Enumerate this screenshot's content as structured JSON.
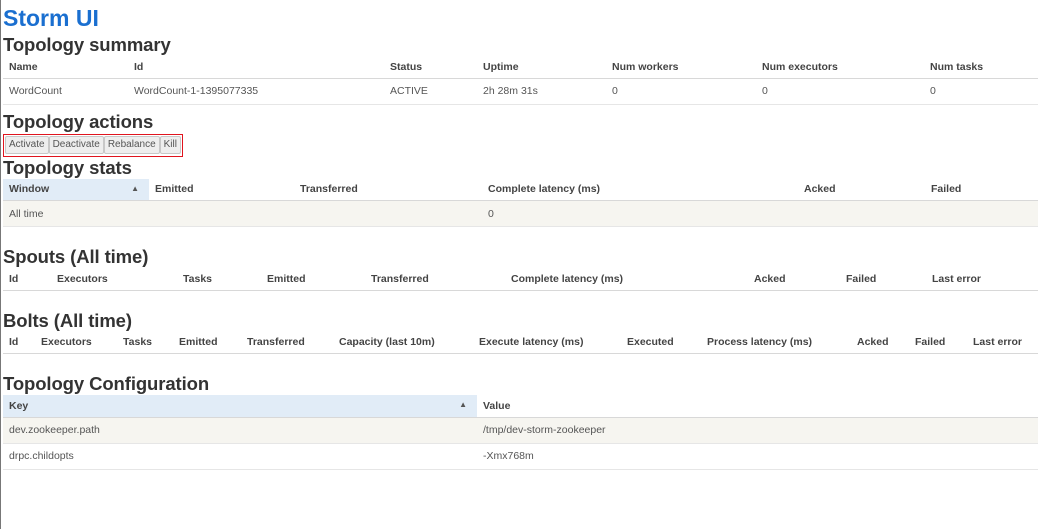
{
  "app_title": "Storm UI",
  "sections": {
    "summary": "Topology summary",
    "actions": "Topology actions",
    "stats": "Topology stats",
    "spouts": "Spouts (All time)",
    "bolts": "Bolts (All time)",
    "config": "Topology Configuration"
  },
  "summary": {
    "headers": [
      "Name",
      "Id",
      "Status",
      "Uptime",
      "Num workers",
      "Num executors",
      "Num tasks"
    ],
    "row": [
      "WordCount",
      "WordCount-1-1395077335",
      "ACTIVE",
      "2h 28m 31s",
      "0",
      "0",
      "0"
    ]
  },
  "actions": {
    "activate": "Activate",
    "deactivate": "Deactivate",
    "rebalance": "Rebalance",
    "kill": "Kill"
  },
  "stats": {
    "headers": [
      "Window",
      "Emitted",
      "Transferred",
      "Complete latency (ms)",
      "Acked",
      "Failed"
    ],
    "row": [
      "All time",
      "",
      "",
      "0",
      "",
      ""
    ],
    "sort_icon": "sort-ascending-icon"
  },
  "spouts": {
    "headers": [
      "Id",
      "Executors",
      "Tasks",
      "Emitted",
      "Transferred",
      "Complete latency (ms)",
      "Acked",
      "Failed",
      "Last error"
    ]
  },
  "bolts": {
    "headers": [
      "Id",
      "Executors",
      "Tasks",
      "Emitted",
      "Transferred",
      "Capacity (last 10m)",
      "Execute latency (ms)",
      "Executed",
      "Process latency (ms)",
      "Acked",
      "Failed",
      "Last error"
    ]
  },
  "config": {
    "headers": [
      "Key",
      "Value"
    ],
    "rows": [
      [
        "dev.zookeeper.path",
        "/tmp/dev-storm-zookeeper"
      ],
      [
        "drpc.childopts",
        "-Xmx768m"
      ]
    ],
    "sort_icon": "sort-ascending-icon"
  },
  "colors": {
    "title": "#1a6fd0",
    "highlight_border": "#e0141e",
    "sorted_header": "#e1ecf7",
    "link": "#8b1a1a"
  }
}
